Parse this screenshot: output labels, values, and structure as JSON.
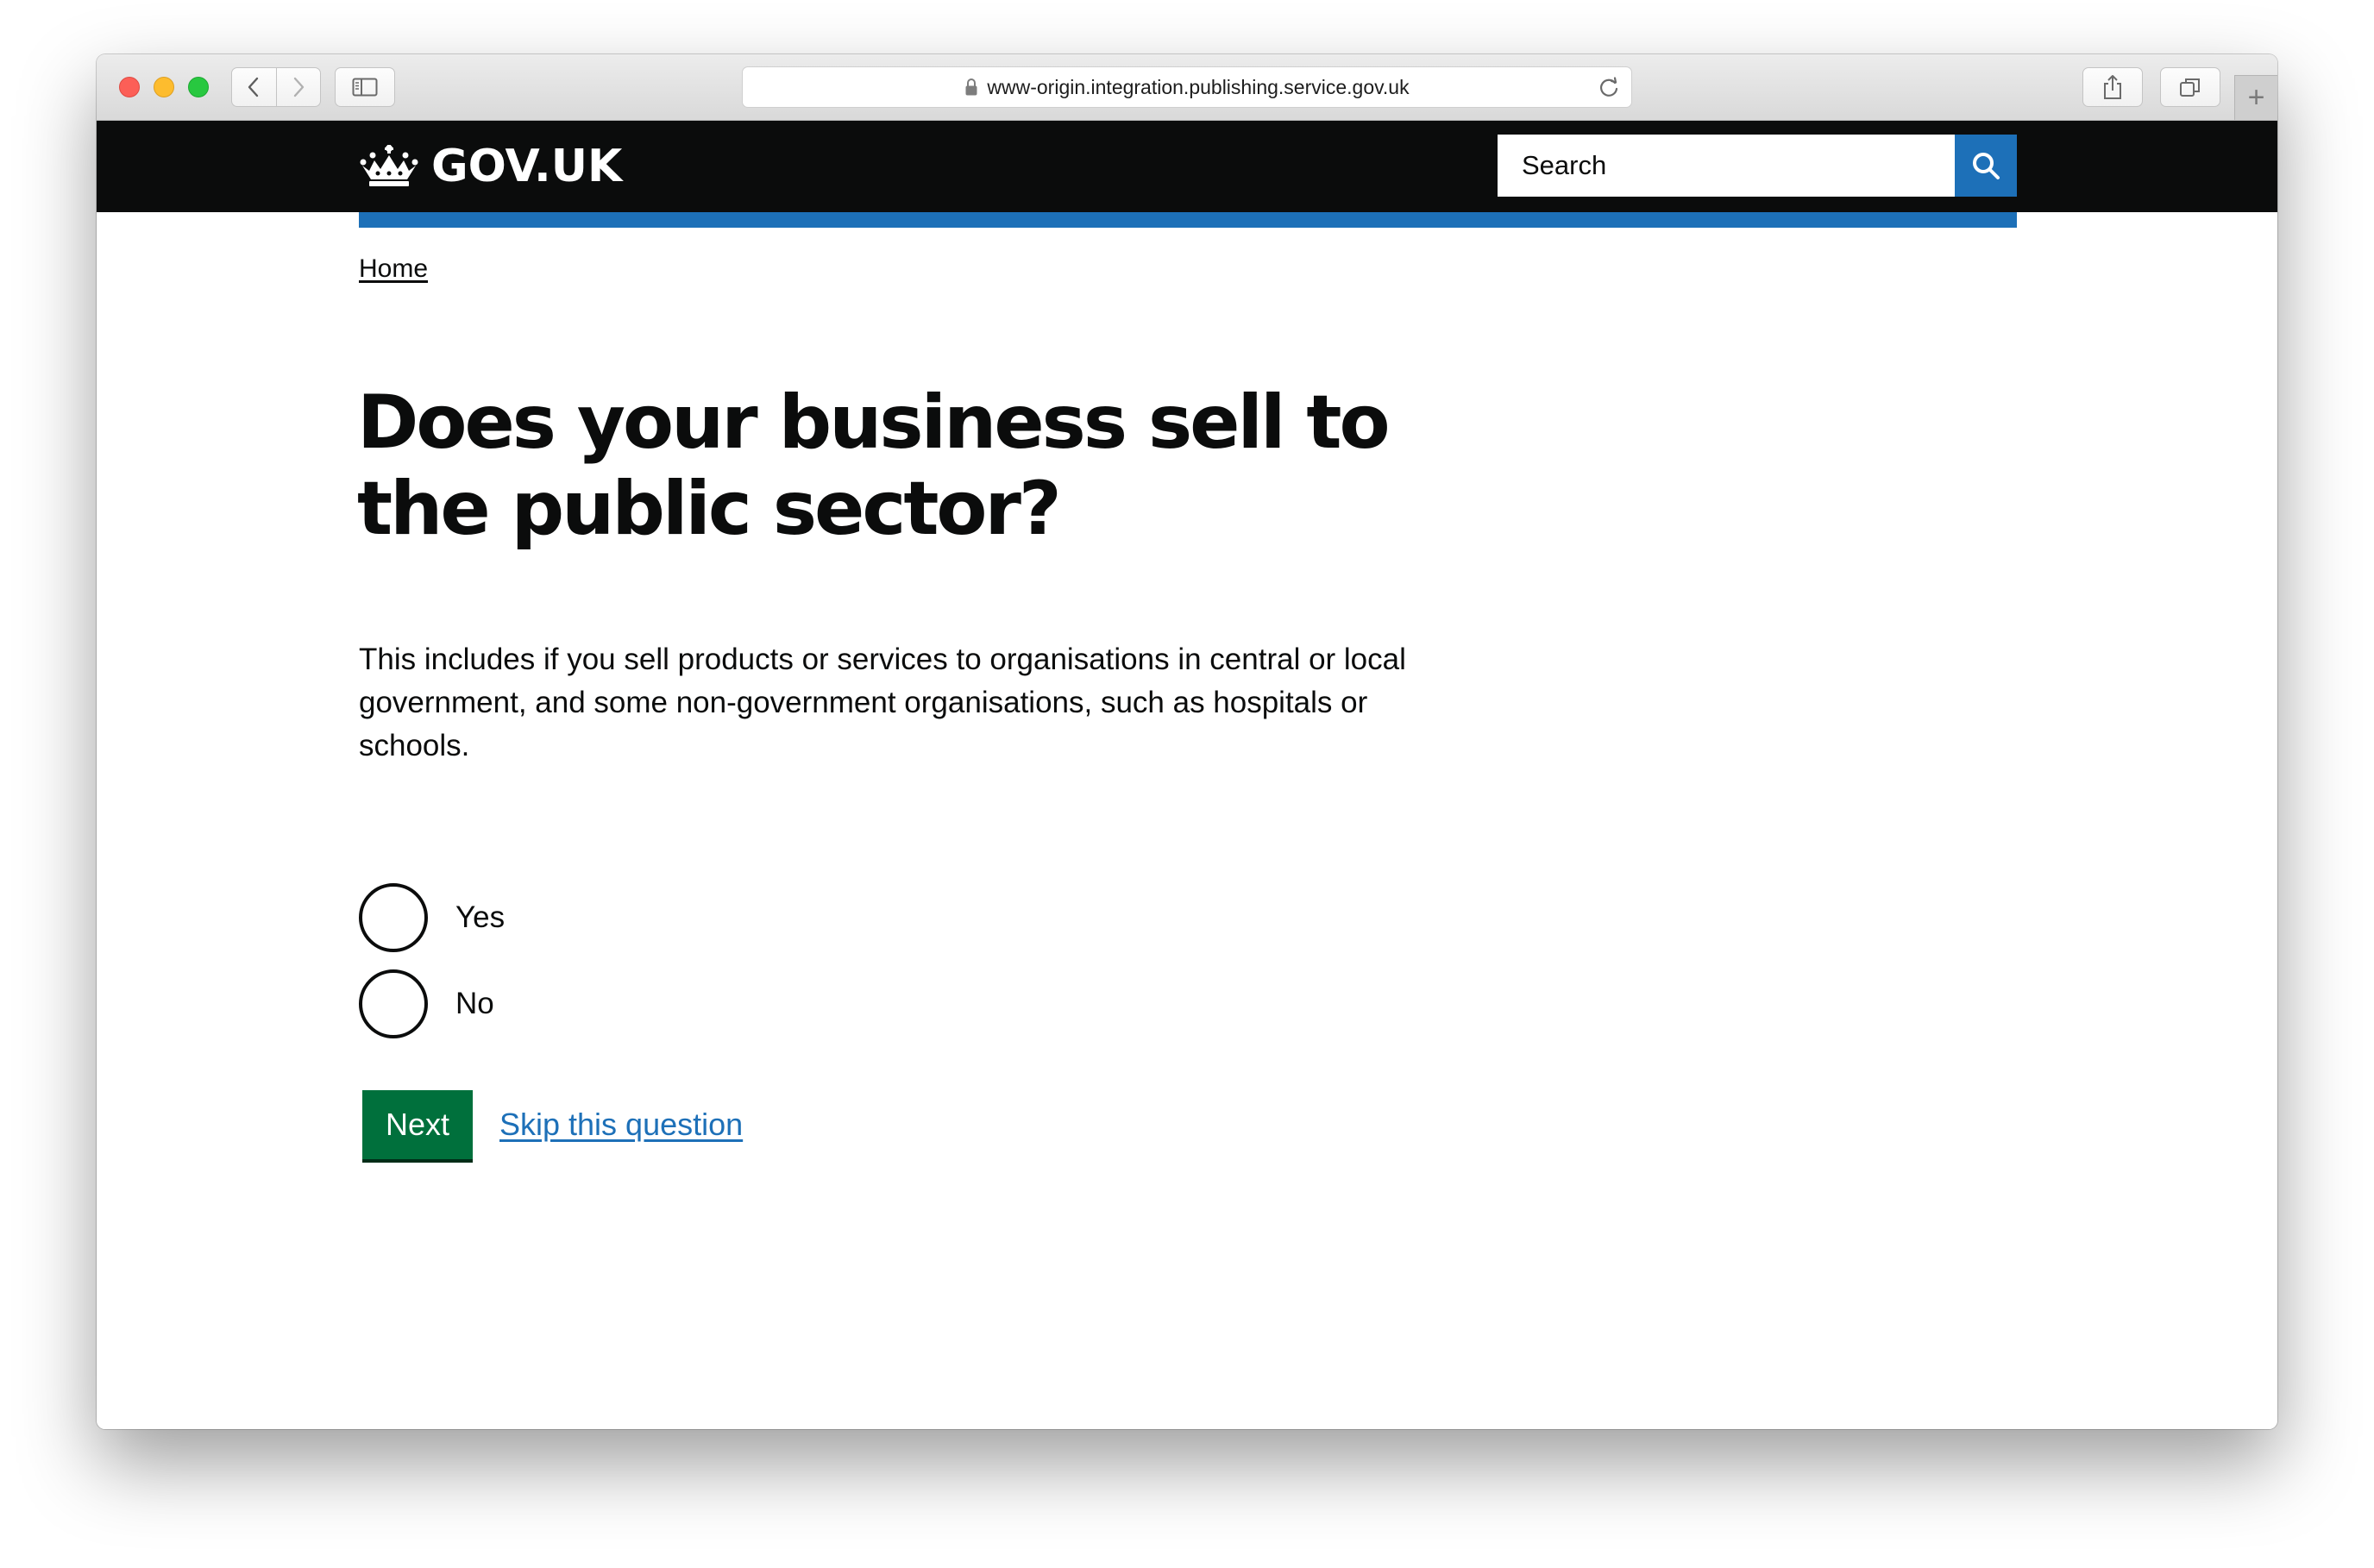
{
  "browser": {
    "url": "www-origin.integration.publishing.service.gov.uk",
    "new_tab_symbol": "+"
  },
  "header": {
    "logo_text": "GOV.UK",
    "search_placeholder": "Search"
  },
  "breadcrumb": {
    "home": "Home"
  },
  "question": {
    "title": "Does your business sell to the public sector?",
    "hint": "This includes if you sell products or services to organisations in central or local government, and some non-government organisations, such as hospitals or schools.",
    "options": [
      {
        "label": "Yes",
        "selected": false
      },
      {
        "label": "No",
        "selected": false
      }
    ]
  },
  "actions": {
    "next_label": "Next",
    "skip_label": "Skip this question"
  },
  "colors": {
    "header_bg": "#0b0c0c",
    "brand_blue": "#1d70b8",
    "button_green": "#00703c",
    "text": "#0b0c0c"
  }
}
